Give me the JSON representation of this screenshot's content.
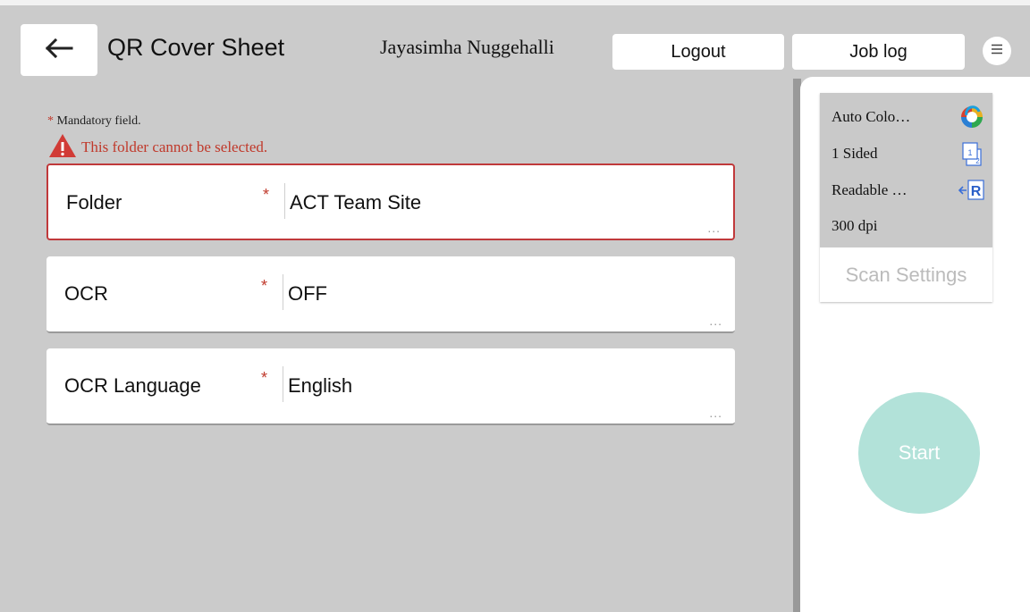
{
  "header": {
    "title": "QR Cover Sheet",
    "user_name": "Jayasimha Nuggehalli",
    "logout_label": "Logout",
    "joblog_label": "Job log",
    "back_icon": "arrow-left-icon",
    "menu_icon": "menu-icon"
  },
  "form": {
    "mandatory_star": "*",
    "mandatory_note": "Mandatory field.",
    "error_message": "This folder cannot be selected.",
    "fields": [
      {
        "label": "Folder",
        "required": "*",
        "value": "ACT Team Site",
        "more": "...",
        "state": "error"
      },
      {
        "label": "OCR",
        "required": "*",
        "value": "OFF",
        "more": "...",
        "state": "normal"
      },
      {
        "label": "OCR Language",
        "required": "*",
        "value": "English",
        "more": "...",
        "state": "normal"
      }
    ]
  },
  "scan_summary": {
    "items": [
      {
        "text": "Auto Colo…",
        "icon": "auto-color-icon"
      },
      {
        "text": "1 Sided",
        "icon": "one-sided-icon"
      },
      {
        "text": "Readable …",
        "icon": "readable-direction-icon"
      },
      {
        "text": "300 dpi",
        "icon": ""
      }
    ],
    "settings_label": "Scan Settings"
  },
  "start_label": "Start",
  "colors": {
    "background": "#cbcbcb",
    "error": "#c0392b",
    "start_button": "#b2e2d9",
    "panel": "#ffffff"
  }
}
